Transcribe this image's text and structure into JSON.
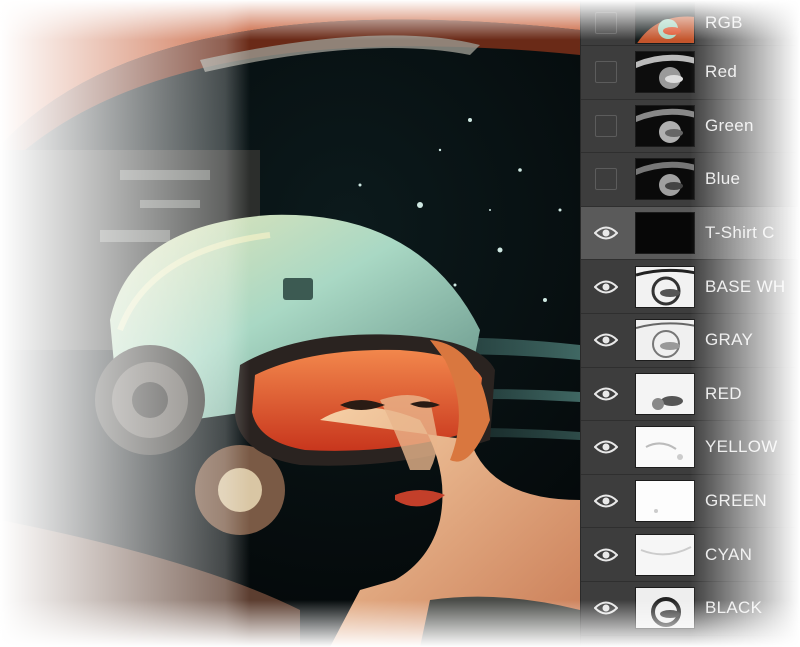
{
  "canvas": {
    "image": "retro-astronaut-woman-illustration"
  },
  "channels": [
    {
      "label": "RGB",
      "visible": false,
      "selected": false,
      "thumb": "rgb"
    },
    {
      "label": "Red",
      "visible": false,
      "selected": false,
      "thumb": "dark"
    },
    {
      "label": "Green",
      "visible": false,
      "selected": false,
      "thumb": "dark"
    },
    {
      "label": "Blue",
      "visible": false,
      "selected": false,
      "thumb": "dark"
    }
  ],
  "layers": [
    {
      "label": "T-Shirt C",
      "visible": true,
      "selected": true,
      "thumb": "black"
    },
    {
      "label": "BASE WH",
      "visible": true,
      "selected": false,
      "thumb": "light"
    },
    {
      "label": "GRAY",
      "visible": true,
      "selected": false,
      "thumb": "light"
    },
    {
      "label": "RED",
      "visible": true,
      "selected": false,
      "thumb": "light"
    },
    {
      "label": "YELLOW",
      "visible": true,
      "selected": false,
      "thumb": "white"
    },
    {
      "label": "GREEN",
      "visible": true,
      "selected": false,
      "thumb": "white"
    },
    {
      "label": "CYAN",
      "visible": true,
      "selected": false,
      "thumb": "white"
    },
    {
      "label": "BLACK",
      "visible": true,
      "selected": false,
      "thumb": "light"
    }
  ],
  "colors": {
    "panel_bg": "#3d3d3d",
    "panel_selected": "#5a5a5a",
    "label_text": "#e8e8e8",
    "visor_orange": "#e0502a",
    "helmet_mint": "#a9d8c4"
  }
}
